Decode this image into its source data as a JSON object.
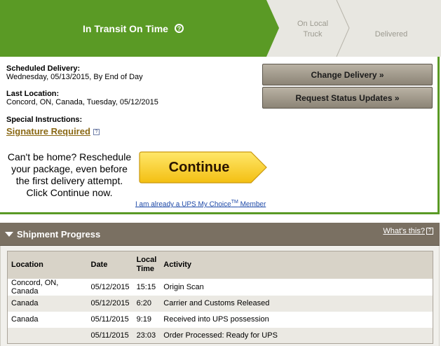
{
  "tracker": {
    "active_label": "In Transit On Time",
    "steps": [
      {
        "line1": "On Local",
        "line2": "Truck"
      },
      {
        "line1": "Delivered",
        "line2": ""
      }
    ],
    "colors": {
      "active": "#5a9a25",
      "inactive": "#e8e7e1"
    }
  },
  "details": {
    "scheduled_label": "Scheduled Delivery:",
    "scheduled_value": "Wednesday, 05/13/2015, By End of Day",
    "last_location_label": "Last Location:",
    "last_location_value": "Concord, ON, Canada, Tuesday, 05/12/2015",
    "special_label": "Special Instructions:",
    "signature_link": "Signature Required",
    "help_icon": "?"
  },
  "actions": {
    "change_delivery": "Change Delivery »",
    "request_updates": "Request Status Updates »"
  },
  "reschedule": {
    "text": "Can't be home? Reschedule your package, even before the first delivery attempt. Click Continue now.",
    "continue_label": "Continue",
    "member_link_pre": "I am already a UPS My Choice",
    "member_link_tm": "TM",
    "member_link_post": " Member"
  },
  "shipment_progress": {
    "title": "Shipment Progress",
    "whats_this": "What's this?",
    "columns": [
      "Location",
      "Date",
      "Local Time",
      "Activity"
    ],
    "rows": [
      {
        "location": "Concord, ON, Canada",
        "date": "05/12/2015",
        "time": "15:15",
        "activity": "Origin Scan"
      },
      {
        "location": "Canada",
        "date": "05/12/2015",
        "time": "6:20",
        "activity": "Carrier and Customs Released"
      },
      {
        "location": "Canada",
        "date": "05/11/2015",
        "time": "9:19",
        "activity": "Received into UPS possession"
      },
      {
        "location": "",
        "date": "05/11/2015",
        "time": "23:03",
        "activity": "Order Processed: Ready for UPS"
      }
    ]
  }
}
